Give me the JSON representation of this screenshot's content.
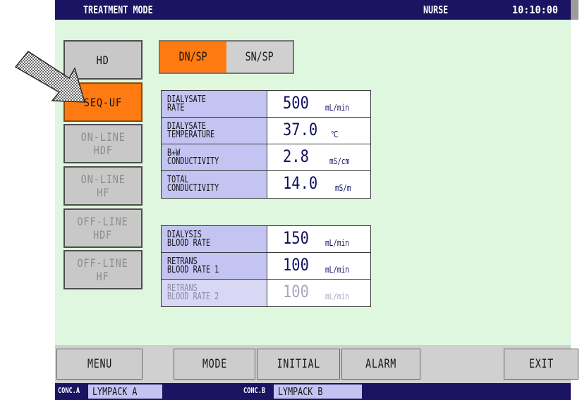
{
  "header": {
    "title": "TREATMENT MODE",
    "user": "NURSE",
    "time": "10:10:00"
  },
  "modes": [
    {
      "label_lines": [
        "HD"
      ],
      "state": "normal"
    },
    {
      "label_lines": [
        "SEQ-UF"
      ],
      "state": "selected"
    },
    {
      "label_lines": [
        "ON-LINE",
        "HDF"
      ],
      "state": "disabled"
    },
    {
      "label_lines": [
        "ON-LINE",
        "HF"
      ],
      "state": "disabled"
    },
    {
      "label_lines": [
        "OFF-LINE",
        "HDF"
      ],
      "state": "disabled"
    },
    {
      "label_lines": [
        "OFF-LINE",
        "HF"
      ],
      "state": "disabled"
    }
  ],
  "needle": {
    "options": [
      "DN/SP",
      "SN/SP"
    ],
    "selected": "DN/SP"
  },
  "dialysate_params": [
    {
      "label_lines": [
        "DIALYSATE",
        "RATE"
      ],
      "value": "500",
      "unit": "mL/min"
    },
    {
      "label_lines": [
        "DIALYSATE",
        "TEMPERATURE"
      ],
      "value": "37.0",
      "unit": "℃"
    },
    {
      "label_lines": [
        "B+W",
        "CONDUCTIVITY"
      ],
      "value": "2.8",
      "unit": "mS/cm"
    },
    {
      "label_lines": [
        "TOTAL",
        "CONDUCTIVITY"
      ],
      "value": "14.0",
      "unit": "mS/m"
    }
  ],
  "blood_params": [
    {
      "label_lines": [
        "DIALYSIS",
        "BLOOD RATE"
      ],
      "value": "150",
      "unit": "mL/min"
    },
    {
      "label_lines": [
        "RETRANS",
        "BLOOD RATE 1"
      ],
      "value": "100",
      "unit": "mL/min"
    },
    {
      "label_lines": [
        "RETRANS",
        "BLOOD RATE 2"
      ],
      "value": "100",
      "unit": "mL/min",
      "dimmed": true
    }
  ],
  "footer_buttons": {
    "menu": "MENU",
    "mode": "MODE",
    "initial": "INITIAL",
    "alarm": "ALARM",
    "exit": "EXIT"
  },
  "status": {
    "conc_a_label": "CONC.A",
    "conc_a_value": "LYMPACK A",
    "conc_b_label": "CONC.B",
    "conc_b_value": "LYMPACK B"
  },
  "colors": {
    "header_bg": "#1a1462",
    "content_bg": "#dff6df",
    "selected": "#ff7a10",
    "param_label_bg": "#c4c4f2"
  },
  "icons": {
    "pointer": "arrow-icon"
  }
}
